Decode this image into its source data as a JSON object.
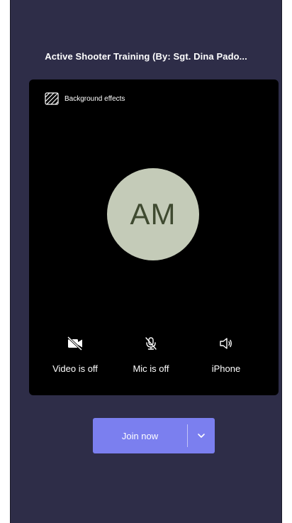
{
  "meeting": {
    "title": "Active Shooter Training (By: Sgt. Dina Pado..."
  },
  "preview": {
    "background_effects_label": "Background effects",
    "avatar_initials": "AM"
  },
  "controls": {
    "video_label": "Video is off",
    "mic_label": "Mic is off",
    "audio_label": "iPhone"
  },
  "join": {
    "label": "Join now"
  },
  "colors": {
    "background": "#2e2d48",
    "preview_background": "#000000",
    "avatar_background": "#c4cbb8",
    "avatar_text": "#3f4a30",
    "accent": "#7b7fef"
  },
  "icons": {
    "background_effects": "background-effects-icon",
    "video_off": "video-off-icon",
    "mic_off": "mic-off-icon",
    "speaker": "speaker-icon",
    "dropdown": "chevron-down-icon"
  }
}
